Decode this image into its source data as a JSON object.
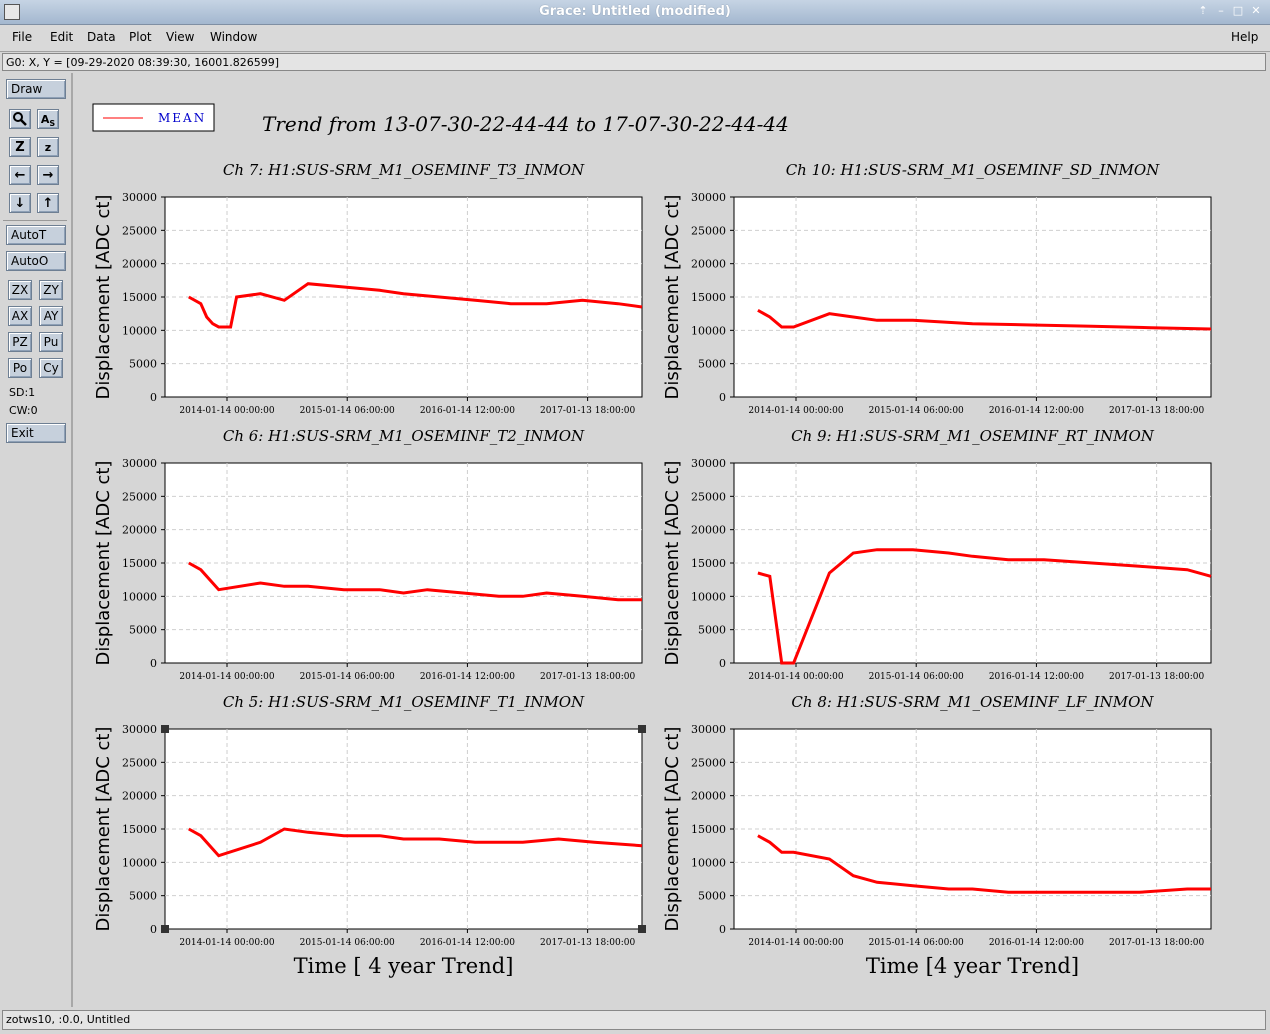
{
  "window": {
    "title": "Grace: Untitled (modified)"
  },
  "menubar": {
    "items": [
      "File",
      "Edit",
      "Data",
      "Plot",
      "View",
      "Window"
    ],
    "help": "Help"
  },
  "locator": {
    "text": "G0: X, Y = [09-29-2020 08:39:30, 16001.826599]"
  },
  "toolbar": {
    "draw": "Draw",
    "autot": "AutoT",
    "autoo": "AutoO",
    "zoom_buttons": [
      "ZX",
      "ZY",
      "AX",
      "AY",
      "PZ",
      "Pu",
      "Po",
      "Cy"
    ],
    "sd": "SD:1",
    "cw": "CW:0",
    "exit": "Exit"
  },
  "status": {
    "text": "zotws10, :0.0, Untitled"
  },
  "figure": {
    "title": "Trend from 13-07-30-22-44-44 to 17-07-30-22-44-44",
    "legend": "MEAN",
    "line_color": "#ff0000"
  },
  "chart_data": [
    {
      "type": "line",
      "title": "Ch 7: H1:SUS-SRM_M1_OSEMINF_T3_INMON",
      "ylabel": "Displacement [ADC ct]",
      "xlabel": "",
      "ylim": [
        0,
        30000
      ],
      "yticks": [
        0,
        5000,
        10000,
        15000,
        20000,
        25000,
        30000
      ],
      "xticks": [
        "2014-01-14 00:00:00",
        "2015-01-14 06:00:00",
        "2016-01-14 12:00:00",
        "2017-01-13 18:00:00"
      ],
      "series": [
        {
          "x": [
            0.2,
            0.3,
            0.35,
            0.4,
            0.45,
            0.55,
            0.6,
            0.8,
            1.0,
            1.2,
            1.5,
            1.8,
            2.0,
            2.3,
            2.6,
            2.9,
            3.2,
            3.5,
            3.8,
            4.0
          ],
          "values": [
            15000,
            14000,
            12000,
            11000,
            10500,
            10500,
            15000,
            15500,
            14500,
            17000,
            16500,
            16000,
            15500,
            15000,
            14500,
            14000,
            14000,
            14500,
            14000,
            13500
          ]
        }
      ]
    },
    {
      "type": "line",
      "title": "Ch 10: H1:SUS-SRM_M1_OSEMINF_SD_INMON",
      "ylabel": "Displacement [ADC ct]",
      "xlabel": "",
      "ylim": [
        0,
        30000
      ],
      "yticks": [
        0,
        5000,
        10000,
        15000,
        20000,
        25000,
        30000
      ],
      "xticks": [
        "2014-01-14 00:00:00",
        "2015-01-14 06:00:00",
        "2016-01-14 12:00:00",
        "2017-01-13 18:00:00"
      ],
      "series": [
        {
          "x": [
            0.2,
            0.3,
            0.4,
            0.5,
            0.8,
            1.0,
            1.2,
            1.5,
            2.0,
            2.5,
            3.0,
            3.5,
            4.0
          ],
          "values": [
            13000,
            12000,
            10500,
            10500,
            12500,
            12000,
            11500,
            11500,
            11000,
            10800,
            10600,
            10400,
            10200
          ]
        }
      ]
    },
    {
      "type": "line",
      "title": "Ch 6: H1:SUS-SRM_M1_OSEMINF_T2_INMON",
      "ylabel": "Displacement [ADC ct]",
      "xlabel": "",
      "ylim": [
        0,
        30000
      ],
      "yticks": [
        0,
        5000,
        10000,
        15000,
        20000,
        25000,
        30000
      ],
      "xticks": [
        "2014-01-14 00:00:00",
        "2015-01-14 06:00:00",
        "2016-01-14 12:00:00",
        "2017-01-13 18:00:00"
      ],
      "series": [
        {
          "x": [
            0.2,
            0.3,
            0.4,
            0.45,
            0.8,
            1.0,
            1.2,
            1.5,
            1.8,
            2.0,
            2.2,
            2.5,
            2.8,
            3.0,
            3.2,
            3.5,
            3.8,
            4.0
          ],
          "values": [
            15000,
            14000,
            12000,
            11000,
            12000,
            11500,
            11500,
            11000,
            11000,
            10500,
            11000,
            10500,
            10000,
            10000,
            10500,
            10000,
            9500,
            9500
          ]
        }
      ]
    },
    {
      "type": "line",
      "title": "Ch 9: H1:SUS-SRM_M1_OSEMINF_RT_INMON",
      "ylabel": "Displacement [ADC ct]",
      "xlabel": "",
      "ylim": [
        0,
        30000
      ],
      "yticks": [
        0,
        5000,
        10000,
        15000,
        20000,
        25000,
        30000
      ],
      "xticks": [
        "2014-01-14 00:00:00",
        "2015-01-14 06:00:00",
        "2016-01-14 12:00:00",
        "2017-01-13 18:00:00"
      ],
      "series": [
        {
          "x": [
            0.2,
            0.3,
            0.4,
            0.5,
            0.8,
            1.0,
            1.2,
            1.5,
            1.8,
            2.0,
            2.3,
            2.6,
            3.0,
            3.4,
            3.8,
            4.0
          ],
          "values": [
            13500,
            13000,
            0,
            0,
            13500,
            16500,
            17000,
            17000,
            16500,
            16000,
            15500,
            15500,
            15000,
            14500,
            14000,
            13000
          ]
        }
      ]
    },
    {
      "type": "line",
      "title": "Ch 5: H1:SUS-SRM_M1_OSEMINF_T1_INMON",
      "ylabel": "Displacement [ADC ct]",
      "xlabel": "Time [ 4 year Trend]",
      "ylim": [
        0,
        30000
      ],
      "yticks": [
        0,
        5000,
        10000,
        15000,
        20000,
        25000,
        30000
      ],
      "xticks": [
        "2014-01-14 00:00:00",
        "2015-01-14 06:00:00",
        "2016-01-14 12:00:00",
        "2017-01-13 18:00:00"
      ],
      "series": [
        {
          "x": [
            0.2,
            0.3,
            0.4,
            0.45,
            0.8,
            1.0,
            1.2,
            1.5,
            1.8,
            2.0,
            2.3,
            2.6,
            3.0,
            3.3,
            3.6,
            4.0
          ],
          "values": [
            15000,
            14000,
            12000,
            11000,
            13000,
            15000,
            14500,
            14000,
            14000,
            13500,
            13500,
            13000,
            13000,
            13500,
            13000,
            12500
          ]
        }
      ]
    },
    {
      "type": "line",
      "title": "Ch 8: H1:SUS-SRM_M1_OSEMINF_LF_INMON",
      "ylabel": "Displacement [ADC ct]",
      "xlabel": "Time [4 year Trend]",
      "ylim": [
        0,
        30000
      ],
      "yticks": [
        0,
        5000,
        10000,
        15000,
        20000,
        25000,
        30000
      ],
      "xticks": [
        "2014-01-14 00:00:00",
        "2015-01-14 06:00:00",
        "2016-01-14 12:00:00",
        "2017-01-13 18:00:00"
      ],
      "series": [
        {
          "x": [
            0.2,
            0.3,
            0.4,
            0.5,
            0.8,
            1.0,
            1.2,
            1.5,
            1.8,
            2.0,
            2.3,
            2.6,
            3.0,
            3.4,
            3.8,
            4.0
          ],
          "values": [
            14000,
            13000,
            11500,
            11500,
            10500,
            8000,
            7000,
            6500,
            6000,
            6000,
            5500,
            5500,
            5500,
            5500,
            6000,
            6000
          ]
        }
      ]
    }
  ]
}
